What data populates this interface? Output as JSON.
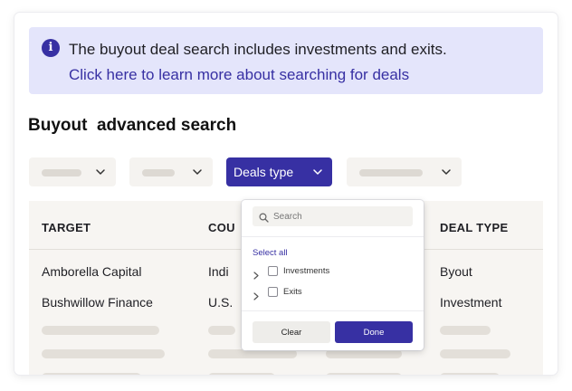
{
  "banner": {
    "icon": "info-icon",
    "message": "The buyout deal search includes investments and exits.",
    "link": "Click here to learn more about searching for deals"
  },
  "title": "Buyout  advanced search",
  "filters": {
    "active_label": "Deals type"
  },
  "table": {
    "columns": [
      "TARGET",
      "COU",
      "DEAL TYPE"
    ],
    "rows": [
      {
        "target": "Amborella Capital",
        "country": "Indi",
        "deal_type": "Byout"
      },
      {
        "target": "Bushwillow Finance",
        "country": "U.S.",
        "deal_type": "Investment"
      }
    ]
  },
  "dropdown": {
    "search_placeholder": "Search",
    "select_all": "Select all",
    "options": [
      "Investments",
      "Exits"
    ],
    "clear_label": "Clear",
    "done_label": "Done"
  },
  "colors": {
    "accent": "#3730a3",
    "banner_bg": "#e4e5fb",
    "table_bg": "#f7f5f2",
    "skeleton": "#e3dfd9"
  }
}
